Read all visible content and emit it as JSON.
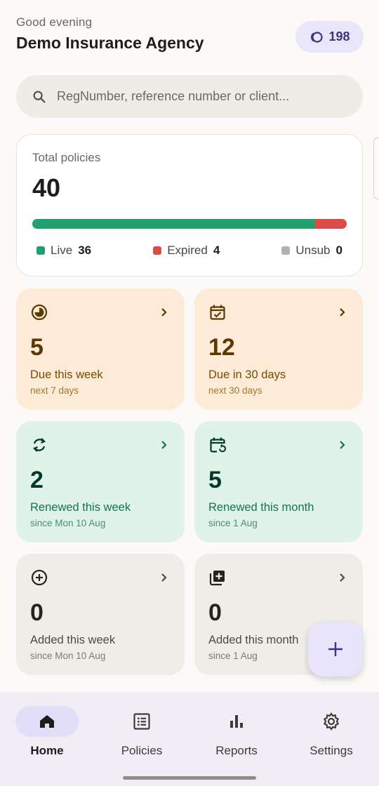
{
  "header": {
    "greeting": "Good evening",
    "agency_name": "Demo Insurance Agency",
    "credits": "198",
    "credits_icon": "coins-icon"
  },
  "search": {
    "placeholder": "RegNumber, reference number or client..."
  },
  "total": {
    "label": "Total policies",
    "value": "40",
    "live_fraction": 0.9,
    "expired_fraction": 0.1,
    "legend": [
      {
        "label": "Live",
        "count": "36",
        "color": "#20a06a"
      },
      {
        "label": "Expired",
        "count": "4",
        "color": "#dc4a4a"
      },
      {
        "label": "Unsub",
        "count": "0",
        "color": "#b3b0ad"
      }
    ]
  },
  "tiles": [
    {
      "value": "5",
      "label": "Due this week",
      "sub": "next 7 days",
      "icon": "pie-clock-icon"
    },
    {
      "value": "12",
      "label": "Due in 30 days",
      "sub": "next 30 days",
      "icon": "calendar-check-icon"
    },
    {
      "value": "2",
      "label": "Renewed this week",
      "sub": "since Mon 10 Aug",
      "icon": "sync-icon"
    },
    {
      "value": "5",
      "label": "Renewed this month",
      "sub": "since 1 Aug",
      "icon": "calendar-refresh-icon"
    },
    {
      "value": "0",
      "label": "Added this week",
      "sub": "since Mon 10 Aug",
      "icon": "add-circle-icon"
    },
    {
      "value": "0",
      "label": "Added this month",
      "sub": "since 1 Aug",
      "icon": "library-add-icon"
    }
  ],
  "nav": [
    {
      "label": "Home",
      "icon": "home-icon",
      "active": true
    },
    {
      "label": "Policies",
      "icon": "list-icon"
    },
    {
      "label": "Reports",
      "icon": "bar-chart-icon"
    },
    {
      "label": "Settings",
      "icon": "gear-icon"
    }
  ],
  "colors": {
    "accent": "#3a3580",
    "live": "#20a06a",
    "expired": "#dc4a4a",
    "due_tile": "#fcebd6",
    "renewed_tile": "#dff3ea",
    "added_tile": "#f0ede8"
  }
}
